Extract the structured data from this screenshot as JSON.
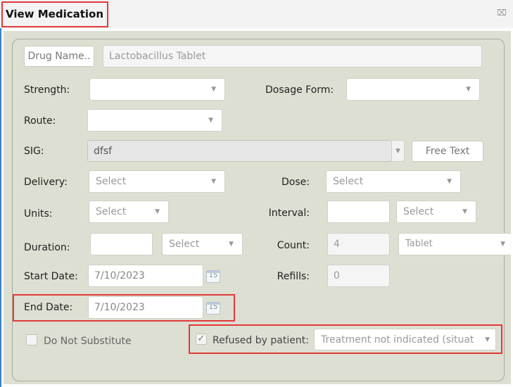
{
  "window": {
    "title": "View Medication",
    "close_icon": "close-icon"
  },
  "drug": {
    "button_label": "Drug Name..",
    "value": "Lactobacillus Tablet"
  },
  "strength": {
    "label": "Strength:",
    "value": ""
  },
  "dosage_form": {
    "label": "Dosage Form:",
    "value": ""
  },
  "route": {
    "label": "Route:",
    "value": ""
  },
  "sig": {
    "label": "SIG:",
    "value": "dfsf",
    "free_text_button": "Free Text"
  },
  "delivery": {
    "label": "Delivery:",
    "value": "Select"
  },
  "dose": {
    "label": "Dose:",
    "value": "Select"
  },
  "units": {
    "label": "Units:",
    "value": "Select"
  },
  "interval": {
    "label": "Interval:",
    "value": "",
    "select_value": "Select"
  },
  "duration": {
    "label": "Duration:",
    "value": "",
    "select_value": "Select"
  },
  "count": {
    "label": "Count:",
    "value": "4",
    "unit_value": "Tablet"
  },
  "start_date": {
    "label": "Start Date:",
    "value": "7/10/2023",
    "cal_day": "15"
  },
  "refills": {
    "label": "Refills:",
    "value": "0"
  },
  "end_date": {
    "label": "End Date:",
    "value": "7/10/2023",
    "cal_day": "15"
  },
  "do_not_substitute": {
    "label": "Do Not Substitute",
    "checked": false
  },
  "refused": {
    "label": "Refused by patient:",
    "checked": true,
    "check_glyph": "✓",
    "reason": "Treatment not indicated (situat"
  },
  "colors": {
    "highlight": "#e03a3a",
    "panel_bg": "#dddfd2",
    "accent": "#3a7fc2"
  }
}
